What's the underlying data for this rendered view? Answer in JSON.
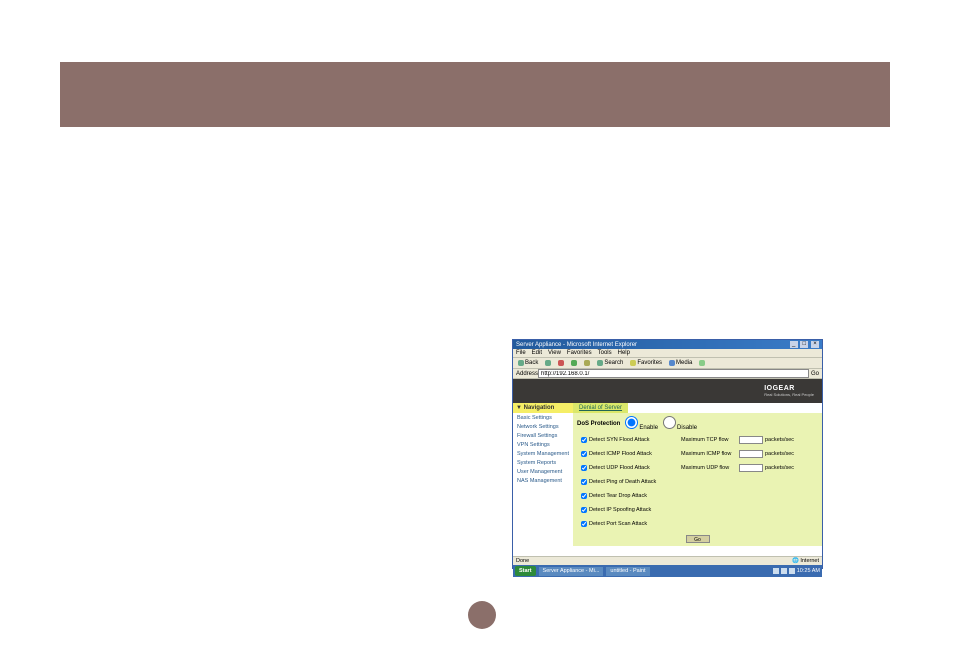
{
  "window": {
    "title": "Server Appliance - Microsoft Internet Explorer",
    "menu": [
      "File",
      "Edit",
      "View",
      "Favorites",
      "Tools",
      "Help"
    ],
    "toolbar": {
      "back": "Back",
      "search": "Search",
      "favorites": "Favorites",
      "media": "Media"
    },
    "address_label": "Address",
    "address_value": "http://192.168.0.1/",
    "go": "Go"
  },
  "brand": {
    "logo": "IOGEAR",
    "tagline": "Real Solutions, Real People"
  },
  "sidebar": {
    "header": "▼ Navigation",
    "items": [
      "Basic Settings",
      "Network Settings",
      "Firewall Settings",
      "VPN Settings",
      "System Management",
      "System Reports",
      "User Management",
      "NAS Management"
    ]
  },
  "section": {
    "title": "Denial of Server",
    "panel_label": "DoS Protection",
    "enable": "Enable",
    "disable": "Disable",
    "checks": [
      "Detect SYN Flood Attack",
      "Detect ICMP Flood Attack",
      "Detect UDP Flood Attack",
      "Detect Ping of Death Attack",
      "Detect Tear Drop Attack",
      "Detect IP Spoofing Attack",
      "Detect Port Scan Attack"
    ],
    "limits": [
      {
        "label": "Maximum TCP flow",
        "unit": "packets/sec"
      },
      {
        "label": "Maximum ICMP flow",
        "unit": "packets/sec"
      },
      {
        "label": "Maximum UDP flow",
        "unit": "packets/sec"
      }
    ],
    "update": "Go"
  },
  "statusbar": {
    "left": "Done",
    "right": "Internet"
  },
  "taskbar": {
    "start": "Start",
    "tasks": [
      "Server Appliance - Mi...",
      "untitled - Paint"
    ],
    "time": "10:25 AM"
  }
}
